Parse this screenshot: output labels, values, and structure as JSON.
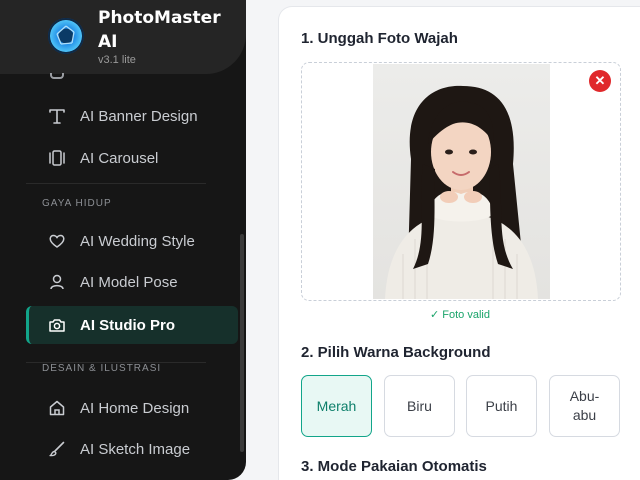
{
  "brand": {
    "title": "PhotoMaster AI",
    "version": "v3.1 lite"
  },
  "sidebar": {
    "items_top": [
      {
        "label": "AI Banner Design",
        "icon": "text-t-icon"
      },
      {
        "label": "AI Carousel",
        "icon": "carousel-icon"
      }
    ],
    "section_lifestyle": "GAYA HIDUP",
    "items_lifestyle": [
      {
        "label": "AI Wedding Style",
        "icon": "heart-icon"
      },
      {
        "label": "AI Model Pose",
        "icon": "user-icon"
      },
      {
        "label": "AI Studio Pro",
        "icon": "camera-icon",
        "active": true
      }
    ],
    "section_design": "DESAIN & ILUSTRASI",
    "items_design": [
      {
        "label": "AI Home Design",
        "icon": "home-icon"
      },
      {
        "label": "AI Sketch Image",
        "icon": "brush-icon"
      }
    ]
  },
  "main": {
    "step1_title": "1. Unggah Foto Wajah",
    "photo_status": "✓ Foto valid",
    "step2_title": "2. Pilih Warna Background",
    "colors": [
      {
        "label": "Merah",
        "selected": true
      },
      {
        "label": "Biru",
        "selected": false
      },
      {
        "label": "Putih",
        "selected": false
      },
      {
        "label": "Abu-abu",
        "selected": false
      }
    ],
    "step3_title": "3. Mode Pakaian Otomatis"
  },
  "colors": {
    "accent": "#12a58a",
    "remove": "#e0282b",
    "sidebar_bg": "#161616"
  }
}
